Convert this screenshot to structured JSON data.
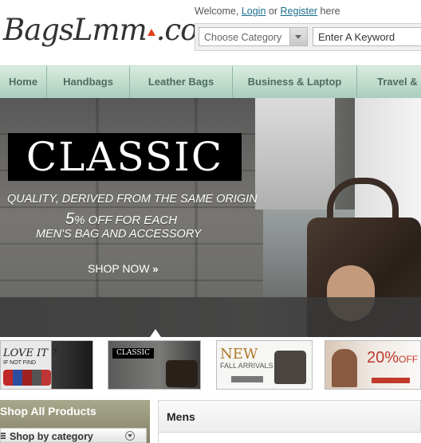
{
  "header": {
    "logo_text": "BagsLmm",
    "logo_suffix": ".com",
    "welcome_prefix": "Welcome,",
    "login_label": "Login",
    "or_text": "or",
    "register_label": "Register",
    "welcome_suffix": "here"
  },
  "search": {
    "category_placeholder": "Choose Category",
    "keyword_value": "Enter A Keyword"
  },
  "nav": {
    "items": [
      {
        "label": "Home"
      },
      {
        "label": "Handbags"
      },
      {
        "label": "Leather Bags"
      },
      {
        "label": "Business & Laptop"
      },
      {
        "label": "Travel & S"
      }
    ]
  },
  "banner": {
    "headline": "CLASSIC",
    "line1": "QUALITY, DERIVED FROM THE SAME ORIGIN",
    "line2_big": "5",
    "line2_rest": "% OFF FOR EACH",
    "line3": "MEN'S BAG AND ACCESSORY",
    "cta_label": "SHOP NOW",
    "cta_chevrons": "»"
  },
  "thumbnails": [
    {
      "title": "LOVE IT ?",
      "subtitle": "IF NOT FIND"
    },
    {
      "title": "CLASSIC"
    },
    {
      "title": "NEW",
      "subtitle": "FALL ARRIVALS"
    },
    {
      "title": "20%",
      "title_suffix": "OFF"
    }
  ],
  "sidebar": {
    "title": "Shop All Products",
    "category_label": "Shop by category"
  },
  "main": {
    "section_title": "Mens"
  },
  "colors": {
    "nav_text": "#4d6e62",
    "link": "#1a6e8e",
    "accent_orange": "#e0401a",
    "promo_red": "#c0392b"
  }
}
